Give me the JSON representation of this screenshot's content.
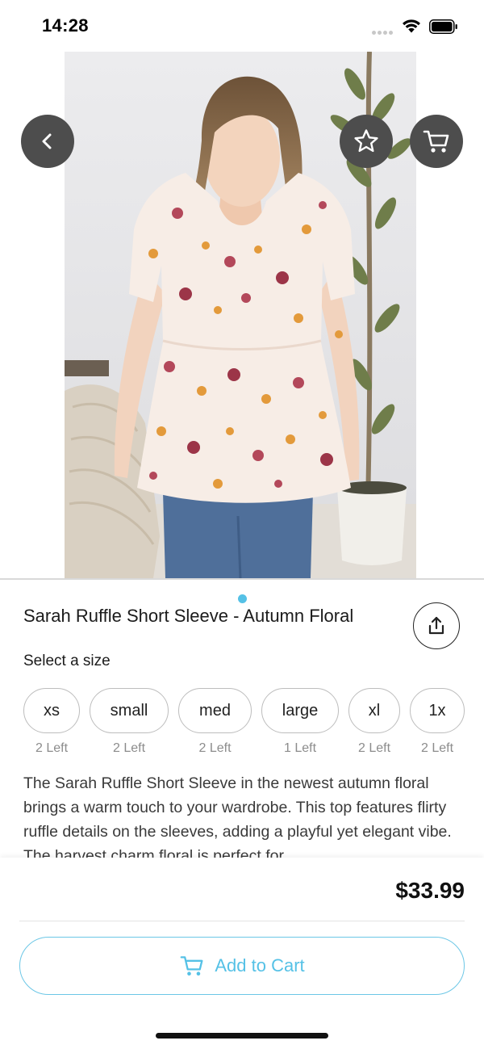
{
  "status_bar": {
    "time": "14:28"
  },
  "header_buttons": {
    "back_icon": "chevron-left-icon",
    "favorite_icon": "star-outline-icon",
    "cart_icon": "cart-icon",
    "button_color": "#4d4d4d"
  },
  "gallery": {
    "page_count": 1,
    "active_page": 1,
    "dot_color": "#55c1e6"
  },
  "product": {
    "title": "Sarah Ruffle Short Sleeve - Autumn Floral",
    "size_label": "Select a size",
    "sizes": [
      {
        "label": "xs",
        "stock": "2 Left"
      },
      {
        "label": "small",
        "stock": "2 Left"
      },
      {
        "label": "med",
        "stock": "2 Left"
      },
      {
        "label": "large",
        "stock": "1 Left"
      },
      {
        "label": "xl",
        "stock": "2 Left"
      },
      {
        "label": "1x",
        "stock": "2 Left"
      }
    ],
    "description": "The Sarah Ruffle Short Sleeve in the newest autumn floral brings a warm touch to your wardrobe. This top features flirty ruffle details on the sleeves, adding a playful yet elegant vibe. The harvest charm floral is perfect for"
  },
  "purchase": {
    "price": "$33.99",
    "add_to_cart_label": "Add to Cart",
    "accent_color": "#55c1e6"
  }
}
